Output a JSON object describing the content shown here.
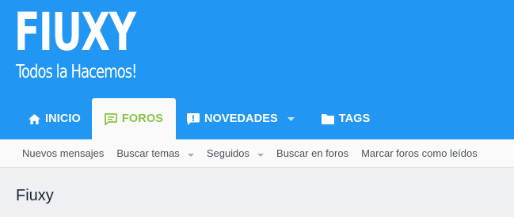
{
  "logo": {
    "word": "FIUXY",
    "tagline": "Todos la Hacemos!"
  },
  "nav": {
    "tabs": [
      {
        "label": "INICIO",
        "icon": "home-icon"
      },
      {
        "label": "FOROS",
        "icon": "comment-icon",
        "active": true
      },
      {
        "label": "NOVEDADES",
        "icon": "alert-comment-icon",
        "has_dropdown": true
      },
      {
        "label": "TAGS",
        "icon": "folder-icon"
      }
    ]
  },
  "subnav": {
    "items": [
      {
        "label": "Nuevos mensajes"
      },
      {
        "label": "Buscar temas",
        "has_dropdown": true
      },
      {
        "label": "Seguidos",
        "has_dropdown": true
      },
      {
        "label": "Buscar en foros"
      },
      {
        "label": "Marcar foros como leídos"
      }
    ]
  },
  "page": {
    "title": "Fiuxy"
  },
  "colors": {
    "header_bg": "#2196f3",
    "active_tab_text": "#8bc34a",
    "subnav_bg": "#fafafa",
    "body_bg": "#eef0f3"
  }
}
